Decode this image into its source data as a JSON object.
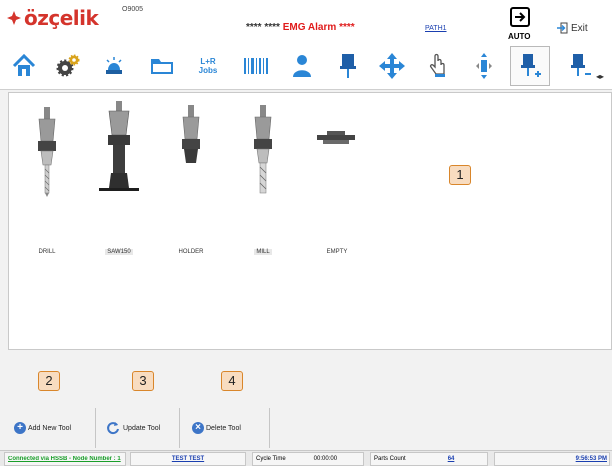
{
  "header": {
    "logo_text": "özçelik",
    "program_number": "O9005",
    "status_stars_1": "****",
    "status_stars_2": "****",
    "emg": "EMG",
    "alarm": "Alarm",
    "status_stars_3": "****",
    "path": "PATH1",
    "auto_label": "AUTO",
    "exit_label": "Exit"
  },
  "toolbar": {
    "jobs_line1": "L+R",
    "jobs_line2": "Jobs",
    "icons": [
      "home-icon",
      "settings-gears-icon",
      "beacon-light-icon",
      "folder-icon",
      "jobs-icon",
      "barcode-icon",
      "operator-icon",
      "tool-holder-icon",
      "move-arrows-icon",
      "touch-hand-icon",
      "axis-arrows-icon",
      "tool-add-icon",
      "tool-remove-icon"
    ]
  },
  "tools": [
    {
      "label": "DRILL",
      "highlight": false
    },
    {
      "label": "SAW150",
      "highlight": true
    },
    {
      "label": "HOLDER",
      "highlight": false
    },
    {
      "label": "MILL",
      "highlight": true
    },
    {
      "label": "EMPTY",
      "highlight": false
    }
  ],
  "callouts": [
    "1",
    "2",
    "3",
    "4"
  ],
  "actions": {
    "add": "Add New Tool",
    "update": "Update Tool",
    "delete": "Delete Tool"
  },
  "statusbar": {
    "connection": "Connected via HSSB - Node Number : 1",
    "test": "TEST TEST",
    "cycle_time_label": "Cycle Time",
    "cycle_time_value": "00:00:00",
    "parts_count_label": "Parts Count",
    "parts_count_value": "64",
    "time": "9:56:53 PM"
  },
  "colors": {
    "brand_red": "#d4342c",
    "accent_blue": "#2a86d6",
    "callout_fill": "#f8dcc0",
    "callout_border": "#d9862b"
  }
}
